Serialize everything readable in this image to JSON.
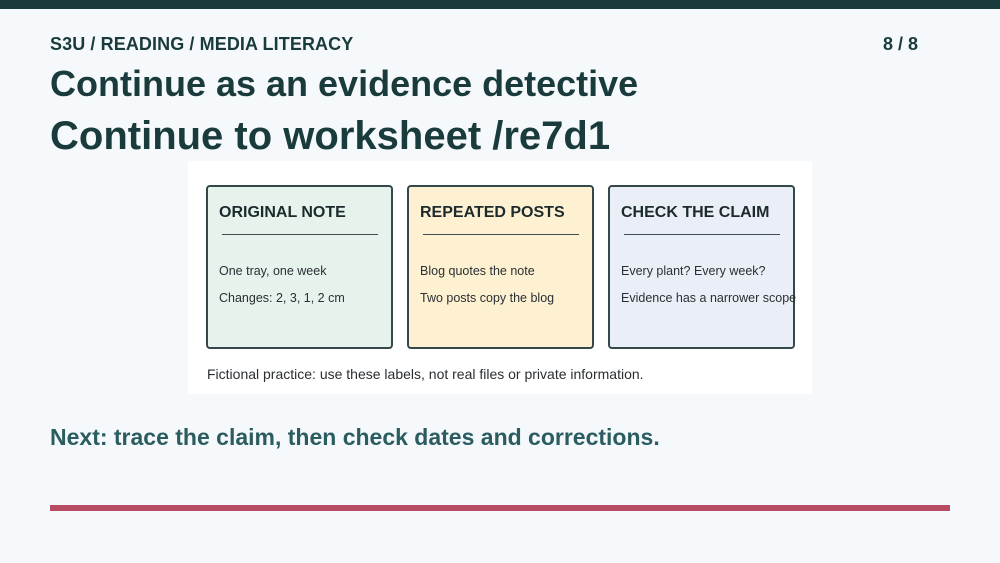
{
  "header": {
    "breadcrumb": "S3U / READING / MEDIA LITERACY",
    "page_counter": "8 / 8"
  },
  "titles": {
    "line1": "Continue as an evidence detective",
    "line2": "Continue to worksheet /re7d1"
  },
  "figure": {
    "cards": [
      {
        "title": "ORIGINAL NOTE",
        "lines": [
          "One tray, one week",
          "Changes: 2, 3, 1, 2 cm"
        ]
      },
      {
        "title": "REPEATED POSTS",
        "lines": [
          "Blog quotes the note",
          "Two posts copy the blog"
        ]
      },
      {
        "title": "CHECK THE CLAIM",
        "lines": [
          "Every plant? Every week?",
          "Evidence has a narrower scope"
        ]
      }
    ],
    "caption": "Fictional practice: use these labels, not real files or private information."
  },
  "footer": {
    "next": "Next: trace the claim, then check dates and corrections."
  },
  "colors": {
    "primary": "#1a3b3b",
    "accent_rule": "#b84c62",
    "card_green": "#e6f2ec",
    "card_yellow": "#fef1d2",
    "card_blue": "#e9eef7"
  }
}
